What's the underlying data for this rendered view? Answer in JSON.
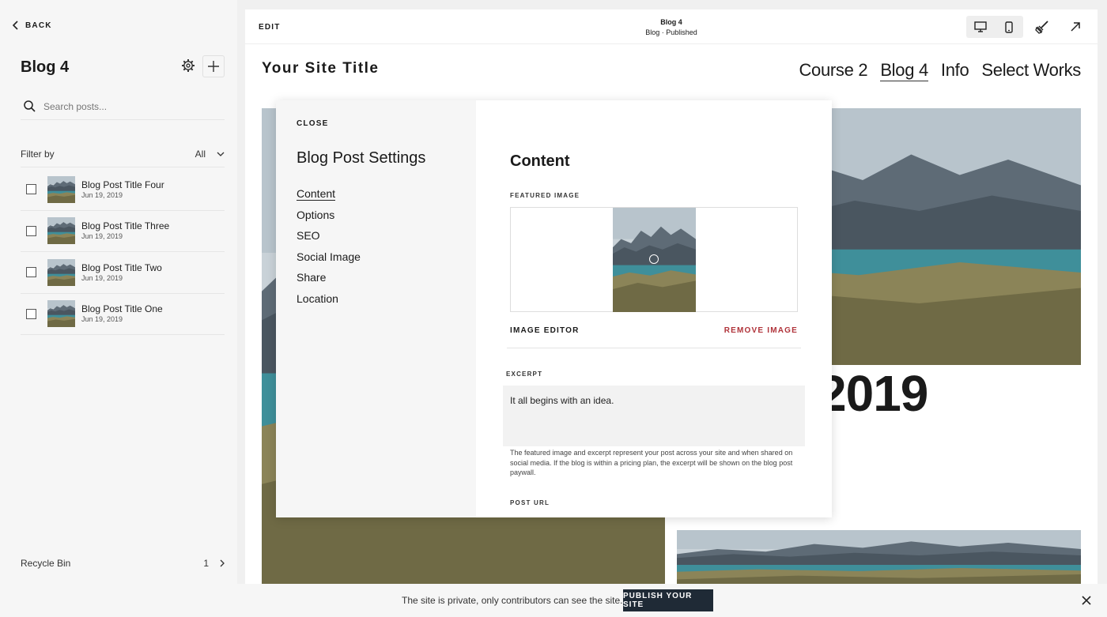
{
  "sidebar": {
    "back_label": "BACK",
    "title": "Blog 4",
    "search_placeholder": "Search posts...",
    "filter_label": "Filter by",
    "filter_value": "All",
    "posts": [
      {
        "title": "Blog Post Title Four",
        "date": "Jun 19, 2019"
      },
      {
        "title": "Blog Post Title Three",
        "date": "Jun 19, 2019"
      },
      {
        "title": "Blog Post Title Two",
        "date": "Jun 19, 2019"
      },
      {
        "title": "Blog Post Title One",
        "date": "Jun 19, 2019"
      }
    ],
    "recycle_label": "Recycle Bin",
    "recycle_count": "1"
  },
  "topbar": {
    "edit_label": "EDIT",
    "page_name": "Blog 4",
    "page_status": "Blog · Published"
  },
  "site": {
    "title": "Your Site Title",
    "nav": [
      "Course 2",
      "Blog 4",
      "Info",
      "Select Works"
    ],
    "active_nav": "Blog 4",
    "date_fragment": "2019"
  },
  "modal": {
    "close_label": "CLOSE",
    "title": "Blog Post Settings",
    "nav": [
      "Content",
      "Options",
      "SEO",
      "Social Image",
      "Share",
      "Location"
    ],
    "active_nav": "Content",
    "content_title": "Content",
    "featured_image_label": "FEATURED IMAGE",
    "image_editor_label": "IMAGE EDITOR",
    "remove_image_label": "REMOVE IMAGE",
    "excerpt_label": "EXCERPT",
    "excerpt_value": "It all begins with an idea.",
    "excerpt_help": "The featured image and excerpt represent your post across your site and when shared on social media. If the blog is within a pricing plan, the excerpt will be shown on the blog post paywall.",
    "post_url_label": "POST URL"
  },
  "bottombar": {
    "private_text": "The site is private, only contributors can see the site.",
    "publish_label": "PUBLISH YOUR SITE"
  },
  "colors": {
    "remove_red": "#b0333a",
    "publish_bg": "#1f2a36",
    "lake": "#3f8f9a"
  }
}
